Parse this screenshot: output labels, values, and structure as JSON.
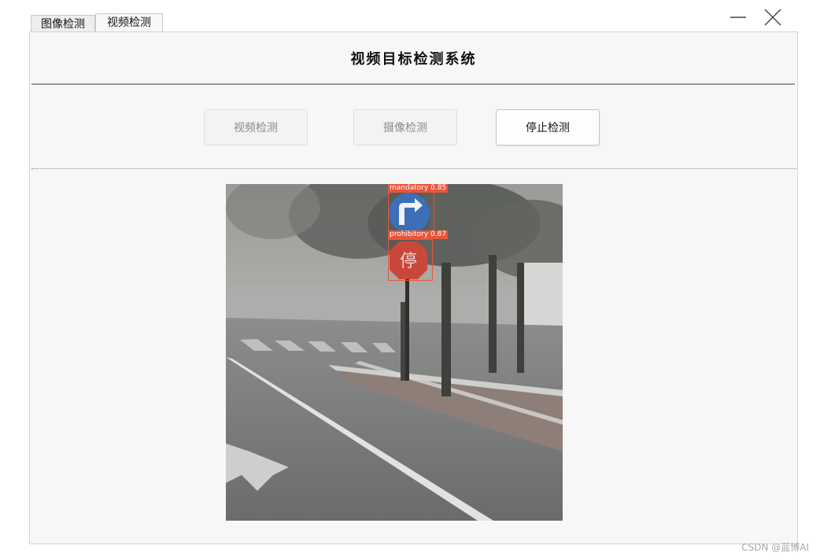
{
  "tabs": [
    {
      "label": "图像检测",
      "active": false
    },
    {
      "label": "视频检测",
      "active": true
    }
  ],
  "window_controls": {
    "minimize_icon": "minimize-icon",
    "close_icon": "close-icon"
  },
  "header": {
    "title": "视频目标检测系统"
  },
  "toolbar": {
    "video_detect_label": "视频检测",
    "camera_detect_label": "摄像检测",
    "stop_detect_label": "停止检测"
  },
  "video": {
    "detections": [
      {
        "label": "mandatory 0.85",
        "class": "mandatory",
        "score": 0.85
      },
      {
        "label": "prohibitory 0.87",
        "class": "prohibitory",
        "score": 0.87
      }
    ],
    "sign_char": "停"
  },
  "watermark": "CSDN @蓝博AI",
  "colors": {
    "bbox": "#e8563a",
    "panel_bg": "#f7f7f7",
    "sign_blue": "#3b6fb8",
    "sign_red": "#c9483b"
  }
}
